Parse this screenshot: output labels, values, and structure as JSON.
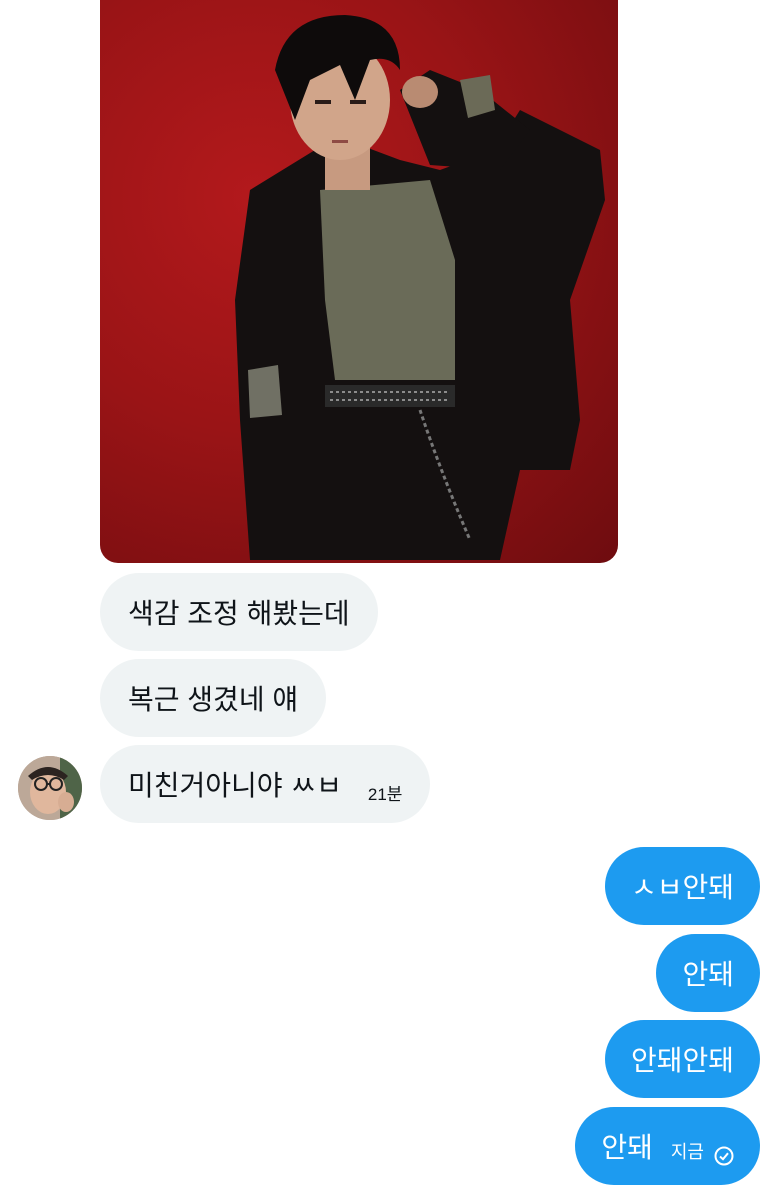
{
  "photo": {
    "icon": "photo-image",
    "accent": "#9a1416"
  },
  "incoming": [
    {
      "text": "색감 조정 해봤는데"
    },
    {
      "text": "복근 생겼네 얘"
    },
    {
      "text": "미친거아니야 ㅆㅂ",
      "time": "21분"
    }
  ],
  "outgoing": [
    {
      "text": "ㅅㅂ안돼"
    },
    {
      "text": "안돼"
    },
    {
      "text": "안돼안돼"
    },
    {
      "text": "안돼",
      "time": "지금",
      "status_icon": "check-circle-icon"
    }
  ],
  "colors": {
    "incoming_bg": "#eff3f4",
    "outgoing_bg": "#1d9bf0"
  }
}
